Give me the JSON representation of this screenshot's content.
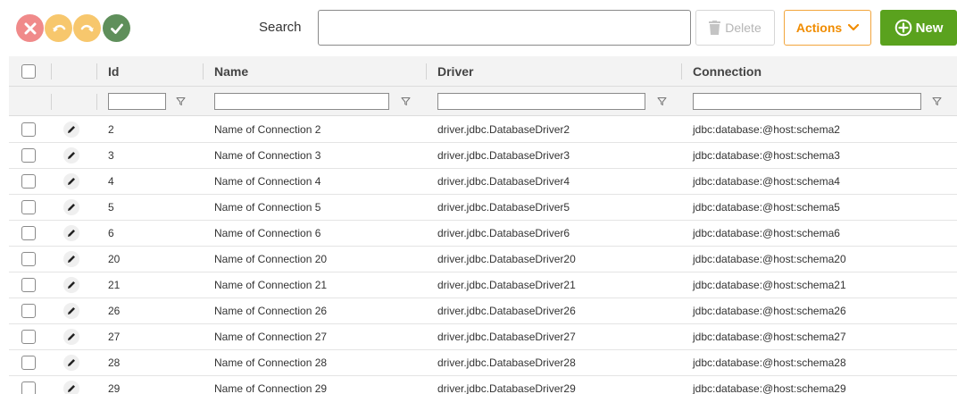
{
  "toolbar": {
    "search_label": "Search",
    "search_value": "",
    "delete_label": "Delete",
    "actions_label": "Actions",
    "new_label": "New",
    "colors": {
      "cancel": "#f08a8a",
      "undo": "#f7c76d",
      "redo": "#f7c76d",
      "confirm": "#5f8f5b",
      "actions_accent": "#f08c00",
      "new_bg": "#5aa21e"
    }
  },
  "table": {
    "columns": [
      {
        "key": "id",
        "label": "Id"
      },
      {
        "key": "name",
        "label": "Name"
      },
      {
        "key": "driver",
        "label": "Driver"
      },
      {
        "key": "connection",
        "label": "Connection"
      }
    ],
    "rows": [
      {
        "id": "2",
        "name": "Name of Connection 2",
        "driver": "driver.jdbc.DatabaseDriver2",
        "connection": "jdbc:database:@host:schema2"
      },
      {
        "id": "3",
        "name": "Name of Connection 3",
        "driver": "driver.jdbc.DatabaseDriver3",
        "connection": "jdbc:database:@host:schema3"
      },
      {
        "id": "4",
        "name": "Name of Connection 4",
        "driver": "driver.jdbc.DatabaseDriver4",
        "connection": "jdbc:database:@host:schema4"
      },
      {
        "id": "5",
        "name": "Name of Connection 5",
        "driver": "driver.jdbc.DatabaseDriver5",
        "connection": "jdbc:database:@host:schema5"
      },
      {
        "id": "6",
        "name": "Name of Connection 6",
        "driver": "driver.jdbc.DatabaseDriver6",
        "connection": "jdbc:database:@host:schema6"
      },
      {
        "id": "20",
        "name": "Name of Connection 20",
        "driver": "driver.jdbc.DatabaseDriver20",
        "connection": "jdbc:database:@host:schema20"
      },
      {
        "id": "21",
        "name": "Name of Connection 21",
        "driver": "driver.jdbc.DatabaseDriver21",
        "connection": "jdbc:database:@host:schema21"
      },
      {
        "id": "26",
        "name": "Name of Connection 26",
        "driver": "driver.jdbc.DatabaseDriver26",
        "connection": "jdbc:database:@host:schema26"
      },
      {
        "id": "27",
        "name": "Name of Connection 27",
        "driver": "driver.jdbc.DatabaseDriver27",
        "connection": "jdbc:database:@host:schema27"
      },
      {
        "id": "28",
        "name": "Name of Connection 28",
        "driver": "driver.jdbc.DatabaseDriver28",
        "connection": "jdbc:database:@host:schema28"
      },
      {
        "id": "29",
        "name": "Name of Connection 29",
        "driver": "driver.jdbc.DatabaseDriver29",
        "connection": "jdbc:database:@host:schema29"
      }
    ]
  }
}
